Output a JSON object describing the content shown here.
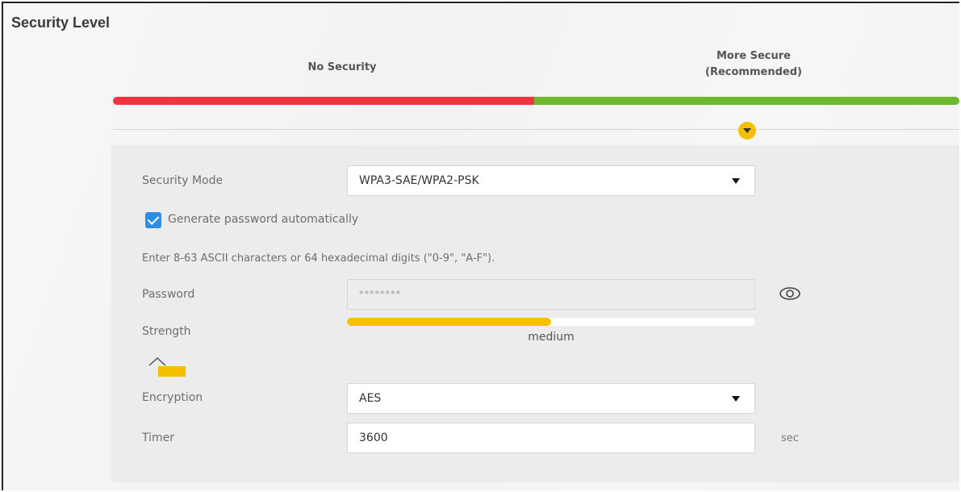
{
  "section_title": "Security Level",
  "levels": {
    "no_security": "No Security",
    "more_secure_line1": "More Secure",
    "more_secure_line2": "(Recommended)"
  },
  "colors": {
    "no_security_bar": "#ee3540",
    "more_secure_bar": "#6cba2b",
    "marker": "#f5c000",
    "strength_fill": "#f5c000",
    "checkbox": "#2d8ee6"
  },
  "form": {
    "security_mode": {
      "label": "Security Mode",
      "value": "WPA3-SAE/WPA2-PSK"
    },
    "generate_password": {
      "label": "Generate password automatically",
      "checked": true
    },
    "hint": "Enter 8-63 ASCII characters or 64 hexadecimal digits (\"0-9\", \"A-F\").",
    "password": {
      "label": "Password",
      "value": "********"
    },
    "strength": {
      "label": "Strength",
      "value": "medium",
      "level_fraction": 0.5
    },
    "encryption": {
      "label": "Encryption",
      "value": "AES"
    },
    "timer": {
      "label": "Timer",
      "value": "3600",
      "unit": "sec"
    }
  },
  "icons": {
    "selector": "chevron-down-icon",
    "dropdown": "caret-down-icon",
    "password_toggle": "eye-icon",
    "collapse": "chevron-up-icon"
  }
}
